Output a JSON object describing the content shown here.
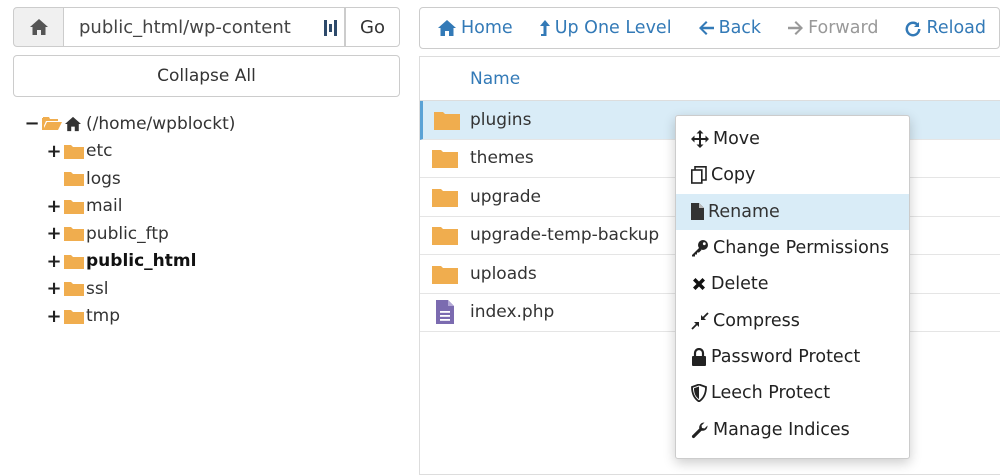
{
  "colors": {
    "accent": "#337ab7",
    "folder": "#f0ad4e",
    "php_icon": "#7b6bb0",
    "selected_row": "#d9ecf7"
  },
  "left": {
    "path_value": "public_html/wp-content",
    "go_label": "Go",
    "collapse_label": "Collapse All",
    "tree": {
      "root": "(/home/wpblockt)",
      "children": [
        {
          "label": "etc",
          "toggle": "+"
        },
        {
          "label": "logs",
          "toggle": ""
        },
        {
          "label": "mail",
          "toggle": "+"
        },
        {
          "label": "public_ftp",
          "toggle": "+"
        },
        {
          "label": "public_html",
          "toggle": "+"
        },
        {
          "label": "ssl",
          "toggle": "+"
        },
        {
          "label": "tmp",
          "toggle": "+"
        }
      ]
    }
  },
  "toolbar": {
    "home": "Home",
    "up": "Up One Level",
    "back": "Back",
    "forward": "Forward",
    "reload": "Reload"
  },
  "filelist": {
    "header": "Name",
    "rows": [
      {
        "name": "plugins",
        "icon": "folder-icon"
      },
      {
        "name": "themes",
        "icon": "folder-icon"
      },
      {
        "name": "upgrade",
        "icon": "folder-icon"
      },
      {
        "name": "upgrade-temp-backup",
        "icon": "folder-icon"
      },
      {
        "name": "uploads",
        "icon": "folder-icon"
      },
      {
        "name": "index.php",
        "icon": "file-icon"
      }
    ]
  },
  "context_menu": {
    "items": [
      {
        "label": "Move",
        "icon": "move-icon"
      },
      {
        "label": "Copy",
        "icon": "copy-icon"
      },
      {
        "label": "Rename",
        "icon": "file-icon"
      },
      {
        "label": "Change Permissions",
        "icon": "key-icon"
      },
      {
        "label": "Delete",
        "icon": "close-icon"
      },
      {
        "label": "Compress",
        "icon": "compress-icon"
      },
      {
        "label": "Password Protect",
        "icon": "lock-icon"
      },
      {
        "label": "Leech Protect",
        "icon": "shield-icon"
      },
      {
        "label": "Manage Indices",
        "icon": "wrench-icon"
      }
    ]
  }
}
